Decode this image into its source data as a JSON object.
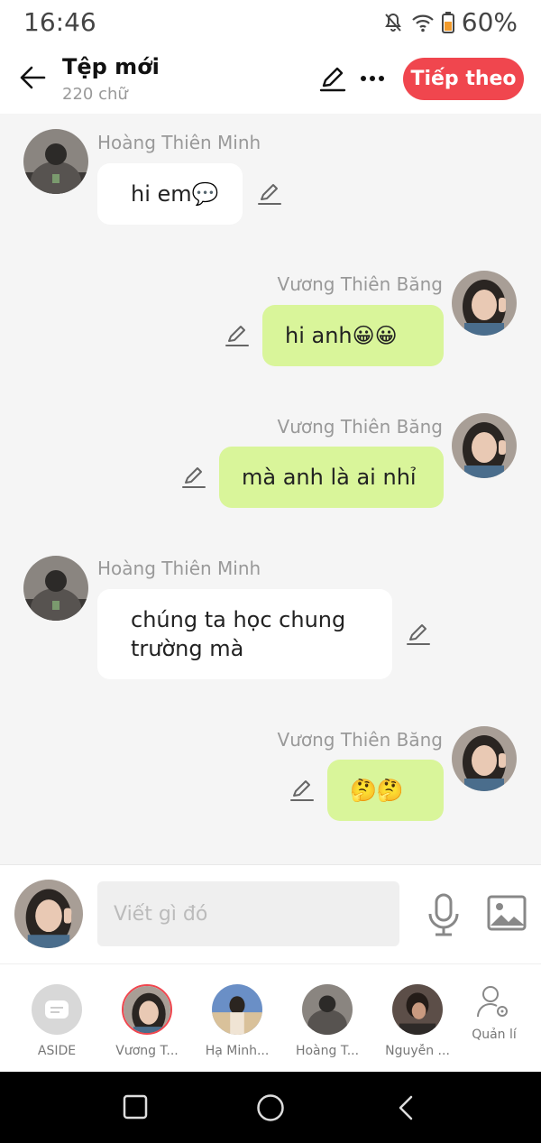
{
  "status": {
    "time": "16:46",
    "battery": "60%"
  },
  "header": {
    "title": "Tệp mới",
    "subtitle": "220 chữ",
    "next_label": "Tiếp theo"
  },
  "messages": [
    {
      "sender": "Hoàng Thiên Minh",
      "side": "left",
      "lines": [
        "hi em💬"
      ]
    },
    {
      "sender": "Vương Thiên Băng",
      "side": "right",
      "lines": [
        "hi anh😀😀"
      ]
    },
    {
      "sender": "Vương Thiên Băng",
      "side": "right",
      "lines": [
        "mà anh là ai nhỉ"
      ]
    },
    {
      "sender": "Hoàng Thiên Minh",
      "side": "left",
      "lines": [
        "chúng ta học chung",
        "trường mà"
      ]
    },
    {
      "sender": "Vương Thiên Băng",
      "side": "right",
      "lines": [
        "🤔🤔"
      ]
    }
  ],
  "composer": {
    "placeholder": "Viết gì đó"
  },
  "characters": [
    {
      "name": "ASIDE"
    },
    {
      "name": "Vương T..."
    },
    {
      "name": "Hạ Minh..."
    },
    {
      "name": "Hoàng T..."
    },
    {
      "name": "Nguyễn ..."
    },
    {
      "name": "Quản lí"
    }
  ],
  "colors": {
    "accent": "#f0464e",
    "right_bubble": "#d9f59a",
    "left_bubble": "#ffffff"
  },
  "icons": [
    "back-arrow-icon",
    "pencil-icon",
    "more-icon",
    "mic-icon",
    "image-icon",
    "manage-icon",
    "square-nav-icon",
    "circle-nav-icon",
    "back-nav-icon"
  ]
}
